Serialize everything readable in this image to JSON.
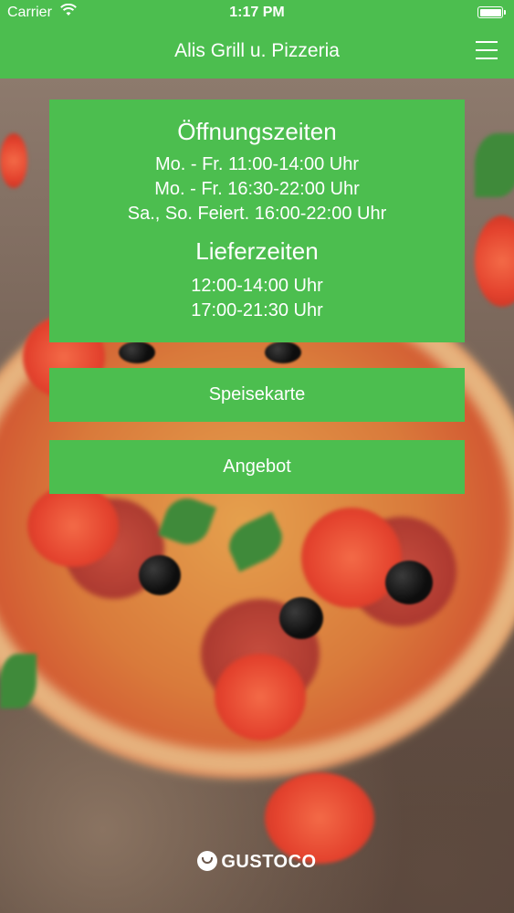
{
  "status_bar": {
    "carrier": "Carrier",
    "time": "1:17 PM",
    "wifi_icon": "wifi-icon",
    "battery_icon": "battery-icon"
  },
  "nav": {
    "title": "Alis Grill u. Pizzeria",
    "menu_icon": "hamburger-menu-icon"
  },
  "info": {
    "opening_heading": "Öffnungszeiten",
    "opening_hours": [
      "Mo. - Fr. 11:00-14:00 Uhr",
      "Mo. - Fr. 16:30-22:00 Uhr",
      "Sa., So. Feiert. 16:00-22:00 Uhr"
    ],
    "delivery_heading": "Lieferzeiten",
    "delivery_hours": [
      "12:00-14:00 Uhr",
      "17:00-21:30 Uhr"
    ]
  },
  "buttons": {
    "menu_label": "Speisekarte",
    "offer_label": "Angebot"
  },
  "footer": {
    "brand": "GUSTOCO",
    "brand_icon": "gustoco-logo-icon"
  },
  "colors": {
    "accent": "#4cbe4f",
    "text": "#ffffff"
  }
}
